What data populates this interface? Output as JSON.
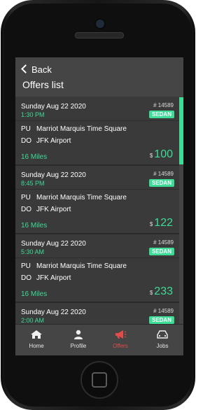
{
  "header": {
    "back_label": "Back",
    "title": "Offers list"
  },
  "offers": [
    {
      "date": "Sunday Aug 22 2020",
      "time": "1:30 PM",
      "number": "# 14589",
      "vehicle": "SEDAN",
      "pickup_tag": "PU",
      "pickup": "Marriot Marquis Time Square",
      "dropoff_tag": "DO",
      "dropoff": "JFK Airport",
      "miles": "16 Miles",
      "currency": "$",
      "price": "100"
    },
    {
      "date": "Sunday Aug 22 2020",
      "time": "8:45 PM",
      "number": "# 14589",
      "vehicle": "SEDAN",
      "pickup_tag": "PU",
      "pickup": "Marriot Marquis Time Square",
      "dropoff_tag": "DO",
      "dropoff": "JFK Airport",
      "miles": "16 Miles",
      "currency": "$",
      "price": "122"
    },
    {
      "date": "Sunday Aug 22 2020",
      "time": "5:30 AM",
      "number": "# 14589",
      "vehicle": "SEDAN",
      "pickup_tag": "PU",
      "pickup": "Marriot Marquis Time Square",
      "dropoff_tag": "DO",
      "dropoff": "JFK Airport",
      "miles": "16 Miles",
      "currency": "$",
      "price": "233"
    },
    {
      "date": "Sunday Aug 22 2020",
      "time": "2:00 AM",
      "number": "# 14589",
      "vehicle": "SEDAN"
    }
  ],
  "nav": {
    "items": [
      {
        "label": "Home",
        "icon": "home-icon",
        "active": false
      },
      {
        "label": "Profile",
        "icon": "user-icon",
        "active": false
      },
      {
        "label": "Offers",
        "icon": "megaphone-icon",
        "active": true
      },
      {
        "label": "Jobs",
        "icon": "car-icon",
        "active": false
      }
    ]
  },
  "colors": {
    "accent": "#3ddc97",
    "active_nav": "#e04b4b",
    "background": "#3d3d3d"
  }
}
